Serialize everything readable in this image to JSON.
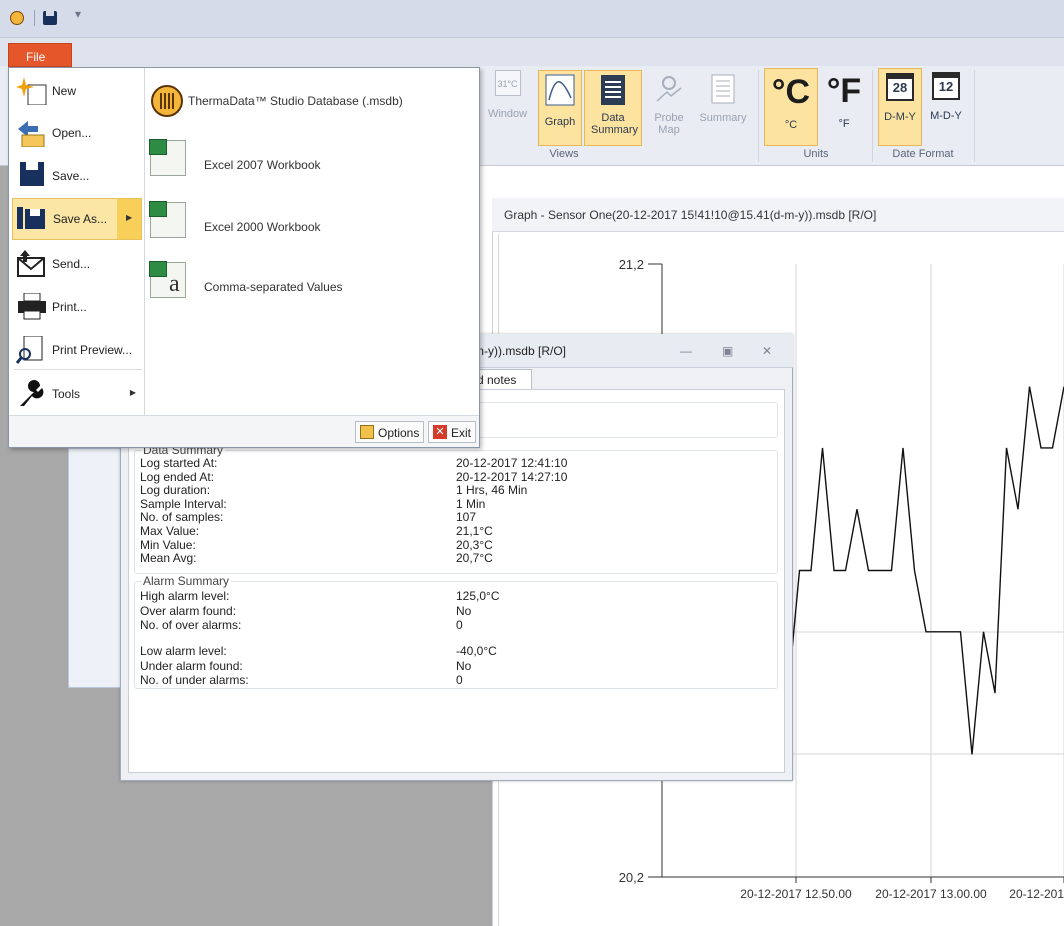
{
  "quick_access": {
    "icons": [
      "app-logo-icon",
      "save-icon",
      "customize-icon"
    ],
    "more": "▾"
  },
  "ribbon": {
    "window_label": "Window",
    "views": [
      {
        "label": "Graph",
        "active": true
      },
      {
        "label": "Data Summary",
        "active": true
      },
      {
        "label": "Probe Map",
        "active": false
      },
      {
        "label": "Summary",
        "active": false
      }
    ],
    "views_group": "Views",
    "units": [
      {
        "symbol": "°C",
        "label": "°C",
        "active": true
      },
      {
        "symbol": "°F",
        "label": "°F",
        "active": false
      }
    ],
    "units_group": "Units",
    "date_formats": [
      {
        "icon_num": "28",
        "label": "D-M-Y",
        "active": true
      },
      {
        "icon_num": "12",
        "label": "M-D-Y",
        "active": false
      }
    ],
    "date_group": "Date Format",
    "misc_icon_text": "31°C"
  },
  "file_menu": {
    "tab_label": "File",
    "items": [
      {
        "label": "New"
      },
      {
        "label": "Open..."
      },
      {
        "label": "Save..."
      },
      {
        "label": "Save As..."
      },
      {
        "label": "Send..."
      },
      {
        "label": "Print..."
      },
      {
        "label": "Print Preview..."
      },
      {
        "label": "Tools"
      }
    ],
    "save_as_options": [
      {
        "label": "ThermaData™ Studio Database (.msdb)"
      },
      {
        "label": "Excel 2007 Workbook"
      },
      {
        "label": "Excel 2000 Workbook"
      },
      {
        "label": "Comma-separated Values"
      }
    ],
    "options_button": "Options",
    "exit_button": "Exit"
  },
  "graph_window": {
    "title": "Graph - Sensor One(20-12-2017 15!41!10@15.41(d-m-y)).msdb [R/O]"
  },
  "chart_data": {
    "type": "line",
    "title": "",
    "xlabel": "",
    "ylabel": "",
    "ylim": [
      20.2,
      21.2
    ],
    "y_tick_labels": [
      "21,2",
      "20,2"
    ],
    "x_tick_labels": [
      "20-12-2017 12.50.00",
      "20-12-2017 13.00.00",
      "20-12-201"
    ],
    "grid": true,
    "series": [
      {
        "x": [
          0,
          1,
          2,
          3,
          4,
          5,
          6,
          7,
          8,
          9,
          10,
          11,
          12,
          13,
          14,
          15,
          16,
          17,
          18,
          19,
          20,
          21,
          22,
          23,
          24,
          25,
          26,
          27,
          28
        ],
        "y": [
          20.5,
          20.8,
          20.5,
          20.9,
          20.5,
          20.7,
          20.7,
          20.9,
          20.7,
          20.7,
          20.8,
          20.7,
          20.7,
          20.7,
          20.9,
          20.7,
          20.6,
          20.6,
          20.6,
          20.6,
          20.4,
          20.6,
          20.5,
          20.9,
          20.8,
          21.0,
          20.9,
          20.9,
          21.0
        ]
      }
    ]
  },
  "data_summary": {
    "window_title": "-m-y)).msdb [R/O]",
    "tab_label": "d notes",
    "data_header": "Data Summary",
    "data_rows": [
      {
        "label": "Log started At:",
        "value": "20-12-2017 12:41:10"
      },
      {
        "label": "Log ended At:",
        "value": "20-12-2017 14:27:10"
      },
      {
        "label": "Log duration:",
        "value": "1 Hrs, 46 Min"
      },
      {
        "label": "Sample Interval:",
        "value": "1 Min"
      },
      {
        "label": "No. of samples:",
        "value": "107"
      },
      {
        "label": "Max Value:",
        "value": "21,1°C"
      },
      {
        "label": "Min Value:",
        "value": "20,3°C"
      },
      {
        "label": "Mean Avg:",
        "value": "20,7°C"
      }
    ],
    "alarm_header": "Alarm Summary",
    "alarm_rows": [
      {
        "label": "High alarm level:",
        "value": "125,0°C"
      },
      {
        "label": "Over alarm found:",
        "value": "No"
      },
      {
        "label": "No. of over alarms:",
        "value": "0"
      },
      {
        "label": "Low alarm level:",
        "value": "-40,0°C"
      },
      {
        "label": "Under alarm found:",
        "value": "No"
      },
      {
        "label": "No. of under alarms:",
        "value": "0"
      }
    ]
  }
}
